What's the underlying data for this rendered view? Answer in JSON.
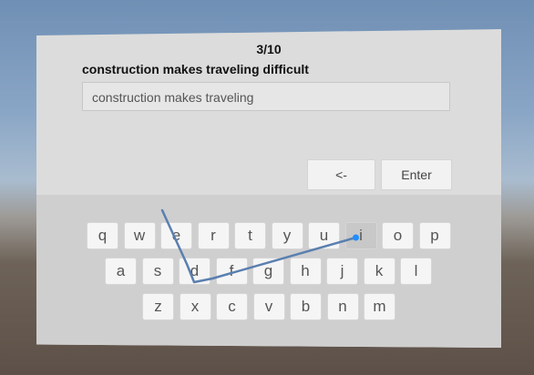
{
  "progress": "3/10",
  "target_sentence": "construction makes traveling difficult",
  "input_text": "construction makes traveling",
  "controls": {
    "backspace_label": "<-",
    "enter_label": "Enter"
  },
  "keyboard": {
    "row1": [
      "q",
      "w",
      "e",
      "r",
      "t",
      "y",
      "u",
      "i",
      "o",
      "p"
    ],
    "row2": [
      "a",
      "s",
      "d",
      "f",
      "g",
      "h",
      "j",
      "k",
      "l"
    ],
    "row3": [
      "z",
      "x",
      "c",
      "v",
      "b",
      "n",
      "m"
    ],
    "active_key": "i"
  },
  "colors": {
    "trace": "#5a7fb0",
    "trace_dot": "#1f8fff"
  }
}
